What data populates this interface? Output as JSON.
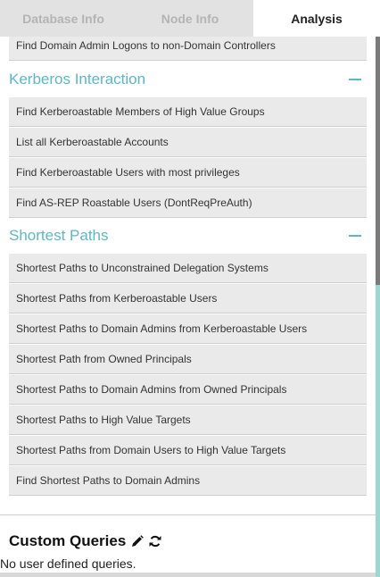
{
  "tabs": [
    {
      "label": "Database Info"
    },
    {
      "label": "Node Info"
    },
    {
      "label": "Analysis",
      "active": true
    }
  ],
  "top_item": {
    "label": "Find Domain Admin Logons to non-Domain Controllers"
  },
  "sections": [
    {
      "title": "Kerberos Interaction",
      "items": [
        "Find Kerberoastable Members of High Value Groups",
        "List all Kerberoastable Accounts",
        "Find Kerberoastable Users with most privileges",
        "Find AS-REP Roastable Users (DontReqPreAuth)"
      ]
    },
    {
      "title": "Shortest Paths",
      "items": [
        "Shortest Paths to Unconstrained Delegation Systems",
        "Shortest Paths from Kerberoastable Users",
        "Shortest Paths to Domain Admins from Kerberoastable Users",
        "Shortest Path from Owned Principals",
        "Shortest Paths to Domain Admins from Owned Principals",
        "Shortest Paths to High Value Targets",
        "Shortest Paths from Domain Users to High Value Targets",
        "Find Shortest Paths to Domain Admins"
      ]
    }
  ],
  "custom_queries": {
    "title": "Custom Queries",
    "empty_text": "No user defined queries.",
    "edit_icon": "pencil-icon",
    "refresh_icon": "refresh-icon"
  },
  "colors": {
    "accent": "#5bb8c9",
    "item_bg": "#eaeaea",
    "tab_inactive_bg": "#e2e2e2"
  }
}
